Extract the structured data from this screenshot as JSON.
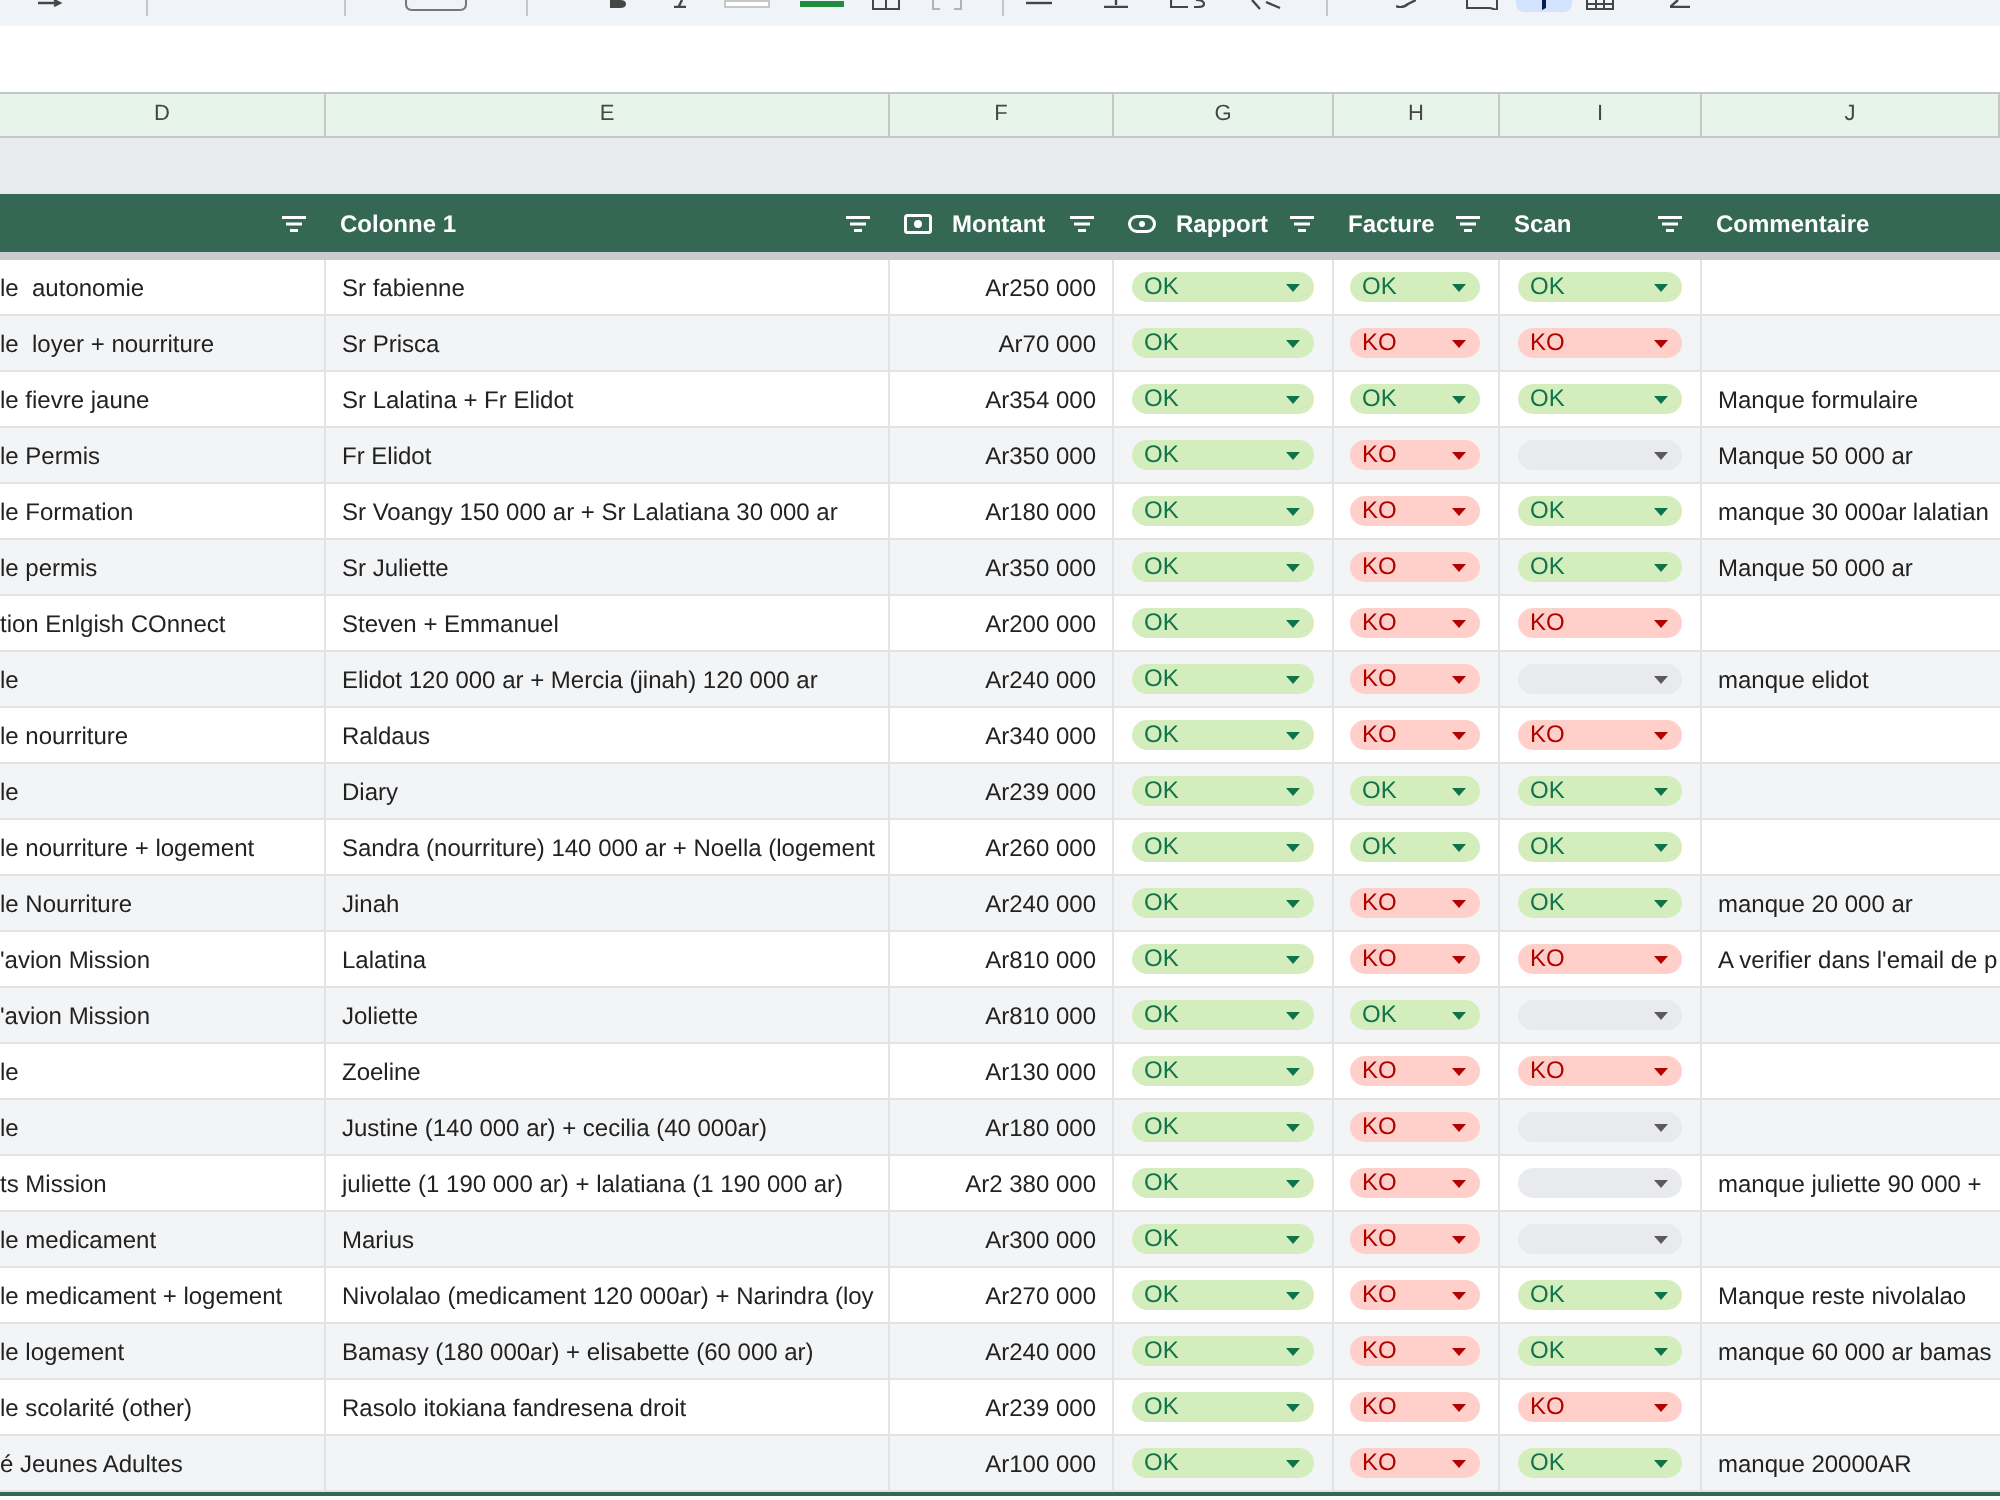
{
  "toolbar": [
    {
      "kind": "redo",
      "on": false
    },
    {
      "kind": "separator"
    },
    {
      "kind": "separator"
    },
    {
      "kind": "font_size",
      "on": false
    },
    {
      "kind": "separator"
    },
    {
      "kind": "bold",
      "on": false
    },
    {
      "kind": "italic",
      "on": false
    },
    {
      "kind": "text_color",
      "on": false
    },
    {
      "kind": "fill_color",
      "on": false
    },
    {
      "kind": "borders",
      "on": false
    },
    {
      "kind": "merge",
      "on": false
    },
    {
      "kind": "separator"
    },
    {
      "kind": "align",
      "on": false
    },
    {
      "kind": "valign",
      "on": false
    },
    {
      "kind": "wrap",
      "on": false
    },
    {
      "kind": "rotate",
      "on": false
    },
    {
      "kind": "separator"
    },
    {
      "kind": "link",
      "on": false
    },
    {
      "kind": "comment",
      "on": false
    },
    {
      "kind": "filter",
      "on": true
    },
    {
      "kind": "table",
      "on": false
    },
    {
      "kind": "functions",
      "on": false
    }
  ],
  "columns": [
    "D",
    "E",
    "F",
    "G",
    "H",
    "I",
    "J"
  ],
  "header": [
    {
      "kind": "plain",
      "filter": true
    },
    {
      "label": "Colonne 1",
      "kind": "plain",
      "filter": true
    },
    {
      "label": "Montant",
      "kind": "currency",
      "filter": true
    },
    {
      "label": "Rapport",
      "kind": "dropdown",
      "filter": true
    },
    {
      "label": "Facture",
      "kind": "plain",
      "filter": true
    },
    {
      "label": "Scan",
      "kind": "plain",
      "filter": true
    },
    {
      "label": "Commentaire",
      "kind": "plain",
      "filter": false
    }
  ],
  "rows": [
    {
      "column_d": "le  autonomie",
      "colonne_1": "Sr fabienne",
      "montant": "Ar250 000",
      "rapport": {
        "label": "OK",
        "kind": "ok"
      },
      "facture": {
        "label": "OK",
        "kind": "ok"
      },
      "scan": {
        "label": "OK",
        "kind": "ok"
      }
    },
    {
      "column_d": "le  loyer + nourriture",
      "colonne_1": "Sr Prisca",
      "montant": "Ar70 000",
      "rapport": {
        "label": "OK",
        "kind": "ok"
      },
      "facture": {
        "label": "KO",
        "kind": "ko"
      },
      "scan": {
        "label": "KO",
        "kind": "ko"
      }
    },
    {
      "column_d": "le fievre jaune",
      "colonne_1": "Sr Lalatina + Fr Elidot",
      "montant": "Ar354 000",
      "rapport": {
        "label": "OK",
        "kind": "ok"
      },
      "facture": {
        "label": "OK",
        "kind": "ok"
      },
      "scan": {
        "label": "OK",
        "kind": "ok"
      },
      "commentaire": "Manque formulaire"
    },
    {
      "column_d": "le Permis",
      "colonne_1": "Fr Elidot",
      "montant": "Ar350 000",
      "rapport": {
        "label": "OK",
        "kind": "ok"
      },
      "facture": {
        "label": "KO",
        "kind": "ko"
      },
      "scan": {
        "kind": "empty"
      },
      "commentaire": "Manque 50 000 ar"
    },
    {
      "column_d": "le Formation",
      "colonne_1": "Sr Voangy 150 000 ar + Sr Lalatiana 30 000 ar",
      "montant": "Ar180 000",
      "rapport": {
        "label": "OK",
        "kind": "ok"
      },
      "facture": {
        "label": "KO",
        "kind": "ko"
      },
      "scan": {
        "label": "OK",
        "kind": "ok"
      },
      "commentaire": "manque 30 000ar lalatian"
    },
    {
      "column_d": "le permis",
      "colonne_1": "Sr Juliette",
      "montant": "Ar350 000",
      "rapport": {
        "label": "OK",
        "kind": "ok"
      },
      "facture": {
        "label": "KO",
        "kind": "ko"
      },
      "scan": {
        "label": "OK",
        "kind": "ok"
      },
      "commentaire": "Manque 50 000 ar"
    },
    {
      "column_d": "tion Enlgish COnnect",
      "colonne_1": "Steven + Emmanuel",
      "montant": "Ar200 000",
      "rapport": {
        "label": "OK",
        "kind": "ok"
      },
      "facture": {
        "label": "KO",
        "kind": "ko"
      },
      "scan": {
        "label": "KO",
        "kind": "ko"
      }
    },
    {
      "column_d": "le",
      "colonne_1": "Elidot 120 000 ar + Mercia (jinah) 120 000 ar",
      "montant": "Ar240 000",
      "rapport": {
        "label": "OK",
        "kind": "ok"
      },
      "facture": {
        "label": "KO",
        "kind": "ko"
      },
      "scan": {
        "kind": "empty"
      },
      "commentaire": "manque elidot"
    },
    {
      "column_d": "le nourriture",
      "colonne_1": "Raldaus",
      "montant": "Ar340 000",
      "rapport": {
        "label": "OK",
        "kind": "ok"
      },
      "facture": {
        "label": "KO",
        "kind": "ko"
      },
      "scan": {
        "label": "KO",
        "kind": "ko"
      }
    },
    {
      "column_d": "le",
      "colonne_1": "Diary",
      "montant": "Ar239 000",
      "rapport": {
        "label": "OK",
        "kind": "ok"
      },
      "facture": {
        "label": "OK",
        "kind": "ok"
      },
      "scan": {
        "label": "OK",
        "kind": "ok"
      }
    },
    {
      "column_d": "le nourriture + logement",
      "colonne_1": "Sandra (nourriture) 140 000 ar + Noella (logement",
      "montant": "Ar260 000",
      "rapport": {
        "label": "OK",
        "kind": "ok"
      },
      "facture": {
        "label": "OK",
        "kind": "ok"
      },
      "scan": {
        "label": "OK",
        "kind": "ok"
      }
    },
    {
      "column_d": "le Nourriture",
      "colonne_1": "Jinah",
      "montant": "Ar240 000",
      "rapport": {
        "label": "OK",
        "kind": "ok"
      },
      "facture": {
        "label": "KO",
        "kind": "ko"
      },
      "scan": {
        "label": "OK",
        "kind": "ok"
      },
      "commentaire": "manque 20 000 ar"
    },
    {
      "column_d": "'avion Mission",
      "colonne_1": "Lalatina",
      "montant": "Ar810 000",
      "rapport": {
        "label": "OK",
        "kind": "ok"
      },
      "facture": {
        "label": "KO",
        "kind": "ko"
      },
      "scan": {
        "label": "KO",
        "kind": "ko"
      },
      "commentaire": "A verifier dans l'email de p"
    },
    {
      "column_d": "'avion Mission",
      "colonne_1": "Joliette",
      "montant": "Ar810 000",
      "rapport": {
        "label": "OK",
        "kind": "ok"
      },
      "facture": {
        "label": "OK",
        "kind": "ok"
      },
      "scan": {
        "kind": "empty"
      }
    },
    {
      "column_d": "le",
      "colonne_1": "Zoeline",
      "montant": "Ar130 000",
      "rapport": {
        "label": "OK",
        "kind": "ok"
      },
      "facture": {
        "label": "KO",
        "kind": "ko"
      },
      "scan": {
        "label": "KO",
        "kind": "ko"
      }
    },
    {
      "column_d": "le",
      "colonne_1": "Justine (140 000 ar) + cecilia (40 000ar)",
      "montant": "Ar180 000",
      "rapport": {
        "label": "OK",
        "kind": "ok"
      },
      "facture": {
        "label": "KO",
        "kind": "ko"
      },
      "scan": {
        "kind": "empty"
      }
    },
    {
      "column_d": "ts Mission",
      "colonne_1": "juliette (1 190 000 ar) + lalatiana (1 190 000 ar)",
      "montant": "Ar2 380 000",
      "rapport": {
        "label": "OK",
        "kind": "ok"
      },
      "facture": {
        "label": "KO",
        "kind": "ko"
      },
      "scan": {
        "kind": "empty"
      },
      "commentaire": "manque juliette 90 000 +"
    },
    {
      "column_d": "le medicament",
      "colonne_1": "Marius",
      "montant": "Ar300 000",
      "rapport": {
        "label": "OK",
        "kind": "ok"
      },
      "facture": {
        "label": "KO",
        "kind": "ko"
      },
      "scan": {
        "kind": "empty"
      }
    },
    {
      "column_d": "le medicament + logement",
      "colonne_1": "Nivolalao (medicament 120 000ar) + Narindra (loy",
      "montant": "Ar270 000",
      "rapport": {
        "label": "OK",
        "kind": "ok"
      },
      "facture": {
        "label": "KO",
        "kind": "ko"
      },
      "scan": {
        "label": "OK",
        "kind": "ok"
      },
      "commentaire": "Manque reste nivolalao"
    },
    {
      "column_d": "le logement",
      "colonne_1": "Bamasy (180 000ar) + elisabette (60 000 ar)",
      "montant": "Ar240 000",
      "rapport": {
        "label": "OK",
        "kind": "ok"
      },
      "facture": {
        "label": "KO",
        "kind": "ko"
      },
      "scan": {
        "label": "OK",
        "kind": "ok"
      },
      "commentaire": "manque 60 000 ar bamas"
    },
    {
      "column_d": "le scolarité (other)",
      "colonne_1": "Rasolo itokiana fandresena droit",
      "montant": "Ar239 000",
      "rapport": {
        "label": "OK",
        "kind": "ok"
      },
      "facture": {
        "label": "KO",
        "kind": "ko"
      },
      "scan": {
        "label": "KO",
        "kind": "ko"
      }
    },
    {
      "column_d": "é Jeunes Adultes",
      "montant": "Ar100 000",
      "rapport": {
        "label": "OK",
        "kind": "ok"
      },
      "facture": {
        "label": "KO",
        "kind": "ko"
      },
      "scan": {
        "label": "OK",
        "kind": "ok"
      },
      "commentaire": "manque 20000AR"
    }
  ]
}
